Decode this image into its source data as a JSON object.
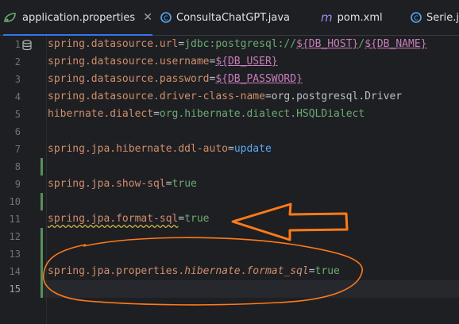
{
  "tabs": [
    {
      "label": "application.properties",
      "icon": "properties-file-icon",
      "active": true
    },
    {
      "label": "ConsultaChatGPT.java",
      "icon": "java-class-icon"
    },
    {
      "label": "pom.xml",
      "icon": "maven-m-icon"
    },
    {
      "label": "Serie.j",
      "icon": "java-class-icon"
    }
  ],
  "editor": {
    "lines": [
      {
        "n": "1",
        "key": "spring.datasource.url",
        "eq": "=",
        "val": "jdbc:postgresql://",
        "p1": "${DB_HOST}",
        "sep": "/",
        "p2": "${DB_NAME}"
      },
      {
        "n": "2",
        "key": "spring.datasource.username",
        "eq": "=",
        "p1": "${DB_USER}"
      },
      {
        "n": "3",
        "key": "spring.datasource.password",
        "eq": "=",
        "p1": "${DB_PASSWORD}"
      },
      {
        "n": "4",
        "key": "spring.datasource.driver-class-name",
        "eq": "=",
        "val": "org.postgresql.Driver"
      },
      {
        "n": "5",
        "key": "hibernate.dialect",
        "eq": "=",
        "val": "org.hibernate.dialect.HSQLDialect"
      },
      {
        "n": "6"
      },
      {
        "n": "7",
        "key": "spring.jpa.hibernate.ddl-auto",
        "eq": "=",
        "val": "update"
      },
      {
        "n": "8"
      },
      {
        "n": "9",
        "key": "spring.jpa.show-sql",
        "eq": "=",
        "val": "true"
      },
      {
        "n": "10"
      },
      {
        "n": "11",
        "key": "spring.jpa.format-sql",
        "eq": "=",
        "val": "true"
      },
      {
        "n": "12"
      },
      {
        "n": "13"
      },
      {
        "n": "14",
        "key_a": "spring.jpa.properties.",
        "key_b": "hibernate",
        "key_c": ".",
        "key_d": "format_sql",
        "eq": "=",
        "val": "true"
      },
      {
        "n": "15"
      }
    ]
  },
  "colors": {
    "background": "#1e1f22",
    "key": "#cf8e6d",
    "value": "#6aab73",
    "placeholder": "#c77dbb",
    "annotation": "#ff7a1a",
    "tab_accent": "#3574f0"
  }
}
